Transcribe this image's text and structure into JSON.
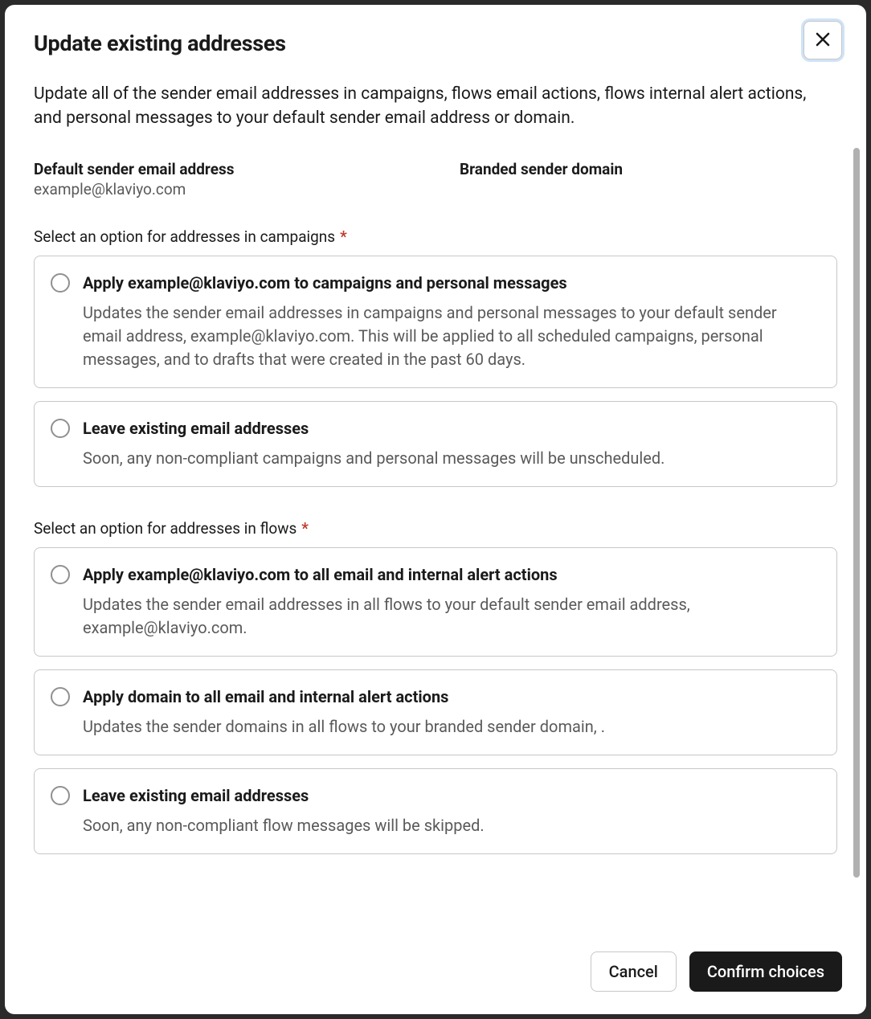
{
  "header": {
    "title": "Update existing addresses"
  },
  "description": "Update all of the sender email addresses in campaigns, flows email actions, flows internal alert actions, and personal messages to your default sender email address or domain.",
  "info": {
    "default_label": "Default sender email address",
    "default_value": "example@klaviyo.com",
    "branded_label": "Branded sender domain",
    "branded_value": ""
  },
  "campaigns_group": {
    "label": "Select an option for addresses in campaigns",
    "options": [
      {
        "title": "Apply example@klaviyo.com to campaigns and personal messages",
        "description": "Updates the sender email addresses in campaigns and personal messages to your default sender email address, example@klaviyo.com. This will be applied to all scheduled campaigns, personal messages, and to drafts that were created in the past 60 days."
      },
      {
        "title": "Leave existing email addresses",
        "description": "Soon, any non-compliant campaigns and personal messages will be unscheduled."
      }
    ]
  },
  "flows_group": {
    "label": "Select an option for addresses in flows",
    "options": [
      {
        "title": "Apply example@klaviyo.com to all email and internal alert actions",
        "description": "Updates the sender email addresses in all flows to your default sender email address, example@klaviyo.com."
      },
      {
        "title": "Apply domain to all email and internal alert actions",
        "description": "Updates the sender domains in all flows to your branded sender domain, ."
      },
      {
        "title": "Leave existing email addresses",
        "description": "Soon, any non-compliant flow messages will be skipped."
      }
    ]
  },
  "footer": {
    "cancel_label": "Cancel",
    "confirm_label": "Confirm choices"
  }
}
